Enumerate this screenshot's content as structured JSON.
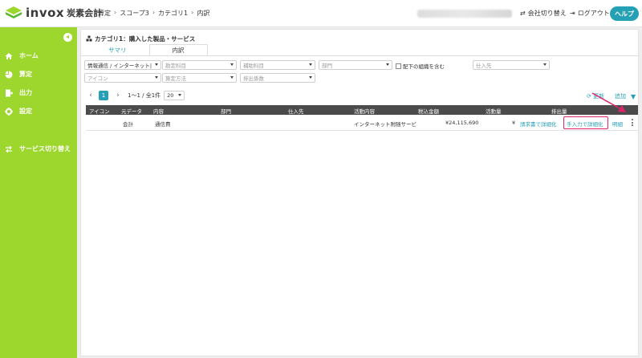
{
  "header": {
    "logo_text": "invox",
    "logo_sub": "炭素会計",
    "breadcrumbs": [
      "算定",
      "スコープ3",
      "カテゴリ1",
      "内訳"
    ],
    "switch_company": "会社切り替え",
    "logout": "ログアウト",
    "help": "ヘルプ"
  },
  "sidebar": {
    "items": [
      {
        "label": "ホーム",
        "icon": "home-icon"
      },
      {
        "label": "算定",
        "icon": "pie-chart-icon"
      },
      {
        "label": "出力",
        "icon": "export-icon"
      },
      {
        "label": "設定",
        "icon": "gear-icon"
      },
      {
        "label": "サービス切り替え",
        "icon": "switch-icon"
      }
    ]
  },
  "panel": {
    "title": "カテゴリ1：購入した製品・サービス",
    "tabs": [
      "サマリ",
      "内訳"
    ],
    "active_tab": "内訳"
  },
  "filters": {
    "category": "情報通信 / インターネット|",
    "account_subject": "勘定科目",
    "sub_account": "補助科目",
    "department": "部門",
    "include_sub_org": "配下の組織を含む",
    "supplier": "仕入先",
    "icon": "アイコン",
    "calc_method": "算定方法",
    "emission_factor": "排出係数"
  },
  "pager": {
    "current_page": "1",
    "range_text": "1〜1 / 全1件",
    "page_size": "20"
  },
  "actions": {
    "refresh": "更新",
    "add": "追加"
  },
  "table": {
    "headers": [
      "アイコン",
      "元データ",
      "内容",
      "部門",
      "仕入先",
      "活動内容",
      "税込金額",
      "活動量",
      "排出量"
    ],
    "rows": [
      {
        "icon": "",
        "source": "会計",
        "content": "通信費",
        "department": "",
        "supplier": "",
        "activity": "インターネット附随サービ",
        "amount": "¥24,115,690",
        "activity_amount": "¥",
        "detail_by_invoice": "請求書で詳細化",
        "detail_manual": "手入力で詳細化",
        "details": "明細"
      }
    ]
  },
  "colors": {
    "brand_green": "#9dd62d",
    "accent_teal": "#26a0b4",
    "highlight_pink": "#e0246c"
  }
}
